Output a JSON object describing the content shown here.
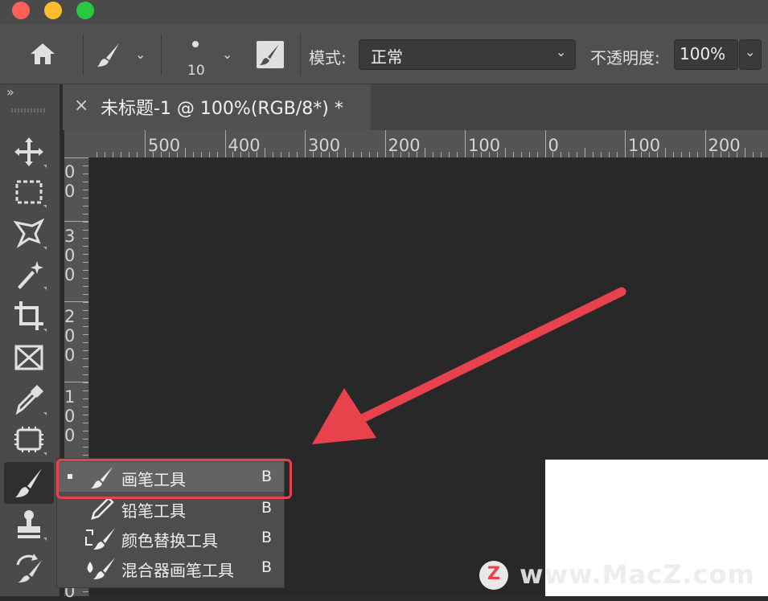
{
  "window": {
    "traffic_lights": [
      "#fe5f57",
      "#febc2e",
      "#28c840"
    ]
  },
  "options_bar": {
    "brush_size": "10",
    "mode_label": "模式:",
    "mode_value": "正常",
    "opacity_label": "不透明度:",
    "opacity_value": "100%"
  },
  "panel": {
    "collapse_glyph": "»"
  },
  "document_tab": {
    "close_glyph": "×",
    "title": "未标题-1 @ 100%(RGB/8*) *"
  },
  "rulers": {
    "horizontal_labels": [
      "500",
      "400",
      "300",
      "200",
      "100",
      "0",
      "100",
      "200"
    ],
    "vertical_labels": [
      {
        "digits": [
          "0",
          "0"
        ]
      },
      {
        "digits": [
          "3",
          "0",
          "0"
        ]
      },
      {
        "digits": [
          "2",
          "0",
          "0"
        ]
      },
      {
        "digits": [
          "1",
          "0",
          "0"
        ]
      },
      {
        "digits": [
          "0"
        ]
      }
    ]
  },
  "tools": [
    "move",
    "marquee",
    "lasso",
    "magic-wand",
    "crop",
    "frame",
    "eyedropper",
    "patch",
    "brush",
    "stamp",
    "history-brush"
  ],
  "flyout": {
    "items": [
      {
        "label": "画笔工具",
        "shortcut": "B",
        "selected": true
      },
      {
        "label": "铅笔工具",
        "shortcut": "B",
        "selected": false
      },
      {
        "label": "颜色替换工具",
        "shortcut": "B",
        "selected": false
      },
      {
        "label": "混合器画笔工具",
        "shortcut": "B",
        "selected": false
      }
    ]
  },
  "annotation": {
    "arrow_color": "#e8424d",
    "highlight_color": "#e8424d"
  },
  "watermark": {
    "logo_letter": "Z",
    "text": "www.MacZ.com"
  }
}
